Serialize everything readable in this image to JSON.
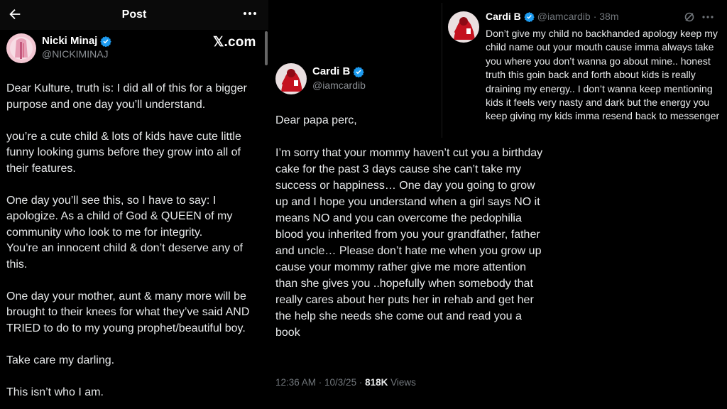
{
  "left_post": {
    "header_title": "Post",
    "author_name": "Nicki Minaj",
    "author_handle": "@NICKIMINAJ",
    "watermark": "𝕏.com",
    "paragraphs": [
      "Dear Kulture, truth is: I did all of this for a bigger purpose and one day you’ll understand.",
      "you’re a cute child & lots of kids have cute little funny looking gums before they grow into all of their features.",
      "One day you’ll see this, so I have to say: I apologize. As a child of God & QUEEN of my community who look to me for integrity.",
      "You’re an innocent child & don’t deserve any of this.",
      "One day your mother, aunt & many more will be brought to their knees for what they’ve said AND TRIED to do to my young prophet/beautiful boy.",
      "Take care my darling.",
      "This isn’t who I am."
    ]
  },
  "middle_post": {
    "author_name": "Cardi B",
    "author_handle": "@iamcardib",
    "paragraphs": [
      "Dear papa perc,",
      "I’m sorry that your mommy haven’t cut you a birthday cake for the past 3 days cause she can’t take my success or happiness… One day you going to grow up and I hope you understand when a girl says NO it means NO and you can overcome the pedophilia blood you inherited from you your grandfather, father and uncle… Please don’t hate me when you grow up cause your mommy rather give me more attention than she gives you ..hopefully when somebody that really cares about her puts her in rehab and get her the help she needs she come out and read you a book"
    ],
    "timestamp": "12:36 AM · 10/3/25 · ",
    "views_count": "818K",
    "views_label": " Views"
  },
  "right_tweet": {
    "author_name": "Cardi B",
    "author_handle": "@iamcardib",
    "age": "· 38m",
    "text": "Don’t give my child no backhanded apology keep my child name out your mouth cause imma always take you where you don’t wanna go about mine.. honest truth this goin back and forth about kids is really draining my energy.. I don’t wanna keep mentioning kids it feels very nasty and dark but the energy you keep giving my kids imma resend back to messenger"
  },
  "colors": {
    "verified": "#1d9bf0",
    "secondary_text": "#71767b",
    "primary_text": "#e7e9ea",
    "background": "#000000"
  },
  "icons": [
    "back-arrow-icon",
    "more-icon",
    "verified-badge-icon",
    "grok-icon"
  ]
}
